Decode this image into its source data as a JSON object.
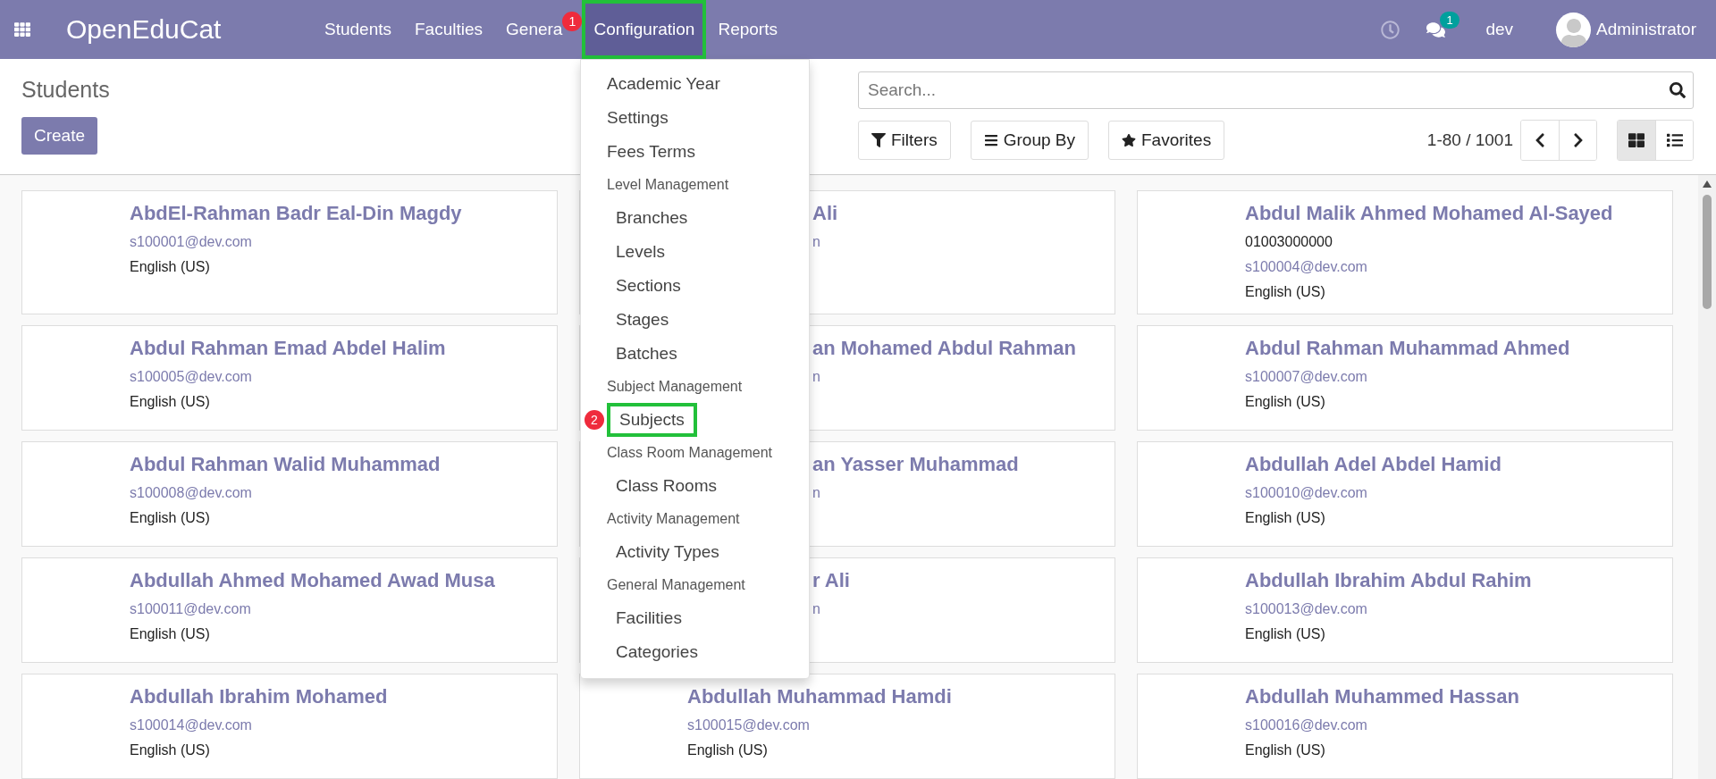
{
  "navbar": {
    "brand": "OpenEduCat",
    "menu": [
      {
        "label": "Students",
        "selected": false,
        "highlighted": false
      },
      {
        "label": "Faculties",
        "selected": false,
        "highlighted": false
      },
      {
        "label": "Genera",
        "selected": false,
        "highlighted": false
      },
      {
        "label": "Configuration",
        "selected": true,
        "highlighted": true,
        "step": "1"
      },
      {
        "label": "Reports",
        "selected": false,
        "highlighted": false
      }
    ],
    "messages_count": "1",
    "database": "dev",
    "user": "Administrator"
  },
  "control_panel": {
    "title": "Students",
    "create": "Create",
    "search": {
      "placeholder": "Search..."
    },
    "search_buttons": [
      {
        "kind": "filter",
        "label": "Filters"
      },
      {
        "kind": "group",
        "label": "Group By"
      },
      {
        "kind": "favorite",
        "label": "Favorites"
      }
    ],
    "pager": "1-80 / 1001",
    "views": [
      {
        "kind": "kanban",
        "selected": true
      },
      {
        "kind": "list",
        "selected": false
      }
    ]
  },
  "dropdown": {
    "items": [
      {
        "kind": "item",
        "label": "Academic Year",
        "highlighted": false
      },
      {
        "kind": "item",
        "label": "Settings",
        "highlighted": false
      },
      {
        "kind": "item",
        "label": "Fees Terms",
        "highlighted": false
      },
      {
        "kind": "header",
        "label": "Level Management",
        "highlighted": false
      },
      {
        "kind": "subitem",
        "label": "Branches",
        "highlighted": false
      },
      {
        "kind": "subitem",
        "label": "Levels",
        "highlighted": false
      },
      {
        "kind": "subitem",
        "label": "Sections",
        "highlighted": false
      },
      {
        "kind": "subitem",
        "label": "Stages",
        "highlighted": false
      },
      {
        "kind": "subitem",
        "label": "Batches",
        "highlighted": false
      },
      {
        "kind": "header",
        "label": "Subject Management",
        "highlighted": false
      },
      {
        "kind": "subitem",
        "label": "Subjects",
        "highlighted": true,
        "step": "2"
      },
      {
        "kind": "header",
        "label": "Class Room Management",
        "highlighted": false
      },
      {
        "kind": "subitem",
        "label": "Class Rooms",
        "highlighted": false
      },
      {
        "kind": "header",
        "label": "Activity Management",
        "highlighted": false
      },
      {
        "kind": "subitem",
        "label": "Activity Types",
        "highlighted": false
      },
      {
        "kind": "header",
        "label": "General Management",
        "highlighted": false
      },
      {
        "kind": "subitem",
        "label": "Facilities",
        "highlighted": false
      },
      {
        "kind": "subitem",
        "label": "Categories",
        "highlighted": false
      }
    ]
  },
  "cards": [
    {
      "name": "AbdEl-Rahman Badr Eal-Din Magdy",
      "email": "s100001@dev.com",
      "language": "English (US)",
      "covered": false
    },
    {
      "name": "Ali",
      "email": "n",
      "covered": true
    },
    {
      "name": "Abdul Malik Ahmed Mohamed Al-Sayed",
      "phone": "01003000000",
      "email": "s100004@dev.com",
      "language": "English (US)",
      "covered": false
    },
    {
      "name": "Abdul Rahman Emad Abdel Halim",
      "email": "s100005@dev.com",
      "language": "English (US)",
      "covered": false
    },
    {
      "name": "an Mohamed Abdul Rahman",
      "email": "n",
      "covered": true
    },
    {
      "name": "Abdul Rahman Muhammad Ahmed",
      "email": "s100007@dev.com",
      "language": "English (US)",
      "covered": false
    },
    {
      "name": "Abdul Rahman Walid Muhammad",
      "email": "s100008@dev.com",
      "language": "English (US)",
      "covered": false
    },
    {
      "name": "an Yasser Muhammad",
      "email": "n",
      "covered": true
    },
    {
      "name": "Abdullah Adel Abdel Hamid",
      "email": "s100010@dev.com",
      "language": "English (US)",
      "covered": false
    },
    {
      "name": "Abdullah Ahmed Mohamed Awad Musa",
      "email": "s100011@dev.com",
      "language": "English (US)",
      "covered": false
    },
    {
      "name": "r Ali",
      "email": "n",
      "covered": true
    },
    {
      "name": "Abdullah Ibrahim Abdul Rahim",
      "email": "s100013@dev.com",
      "language": "English (US)",
      "covered": false
    },
    {
      "name": "Abdullah Ibrahim Mohamed",
      "email": "s100014@dev.com",
      "language": "English (US)",
      "covered": false
    },
    {
      "name": "Abdullah Muhammad Hamdi",
      "email": "s100015@dev.com",
      "language": "English (US)",
      "covered": false
    },
    {
      "name": "Abdullah Muhammed Hassan",
      "email": "s100016@dev.com",
      "language": "English (US)",
      "covered": false
    }
  ]
}
